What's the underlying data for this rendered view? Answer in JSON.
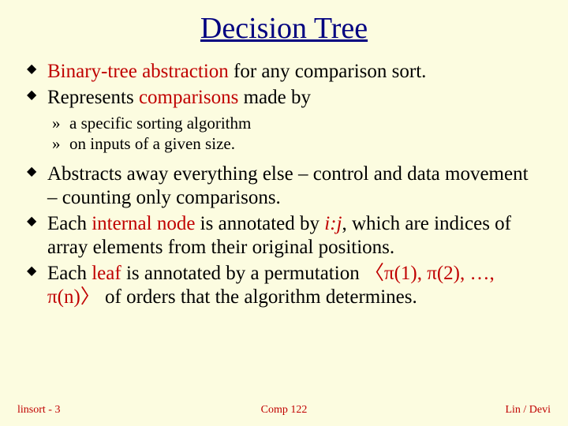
{
  "title": "Decision Tree",
  "bullets": {
    "b1_pre": "Binary-tree abstraction",
    "b1_post": " for any comparison sort.",
    "b2_pre": "Represents ",
    "b2_key": "comparisons",
    "b2_post": " made by",
    "s1": "a specific sorting algorithm",
    "s2": "on inputs of a given size.",
    "b3": "Abstracts away everything else – control and data movement – counting only comparisons.",
    "b4_a": "Each ",
    "b4_key1": "internal node",
    "b4_b": " is annotated by ",
    "b4_ij": "i:j",
    "b4_c": ", which are indices of array elements from their original positions.",
    "b5_a": "Each ",
    "b5_key1": "leaf",
    "b5_b": " is annotated by a permutation ",
    "b5_perm": "〈π(1), π(2), …, π(n)〉",
    "b5_c": " of orders that the algorithm determines."
  },
  "footer": {
    "left": "linsort - 3",
    "center": "Comp 122",
    "right": "Lin / Devi"
  }
}
